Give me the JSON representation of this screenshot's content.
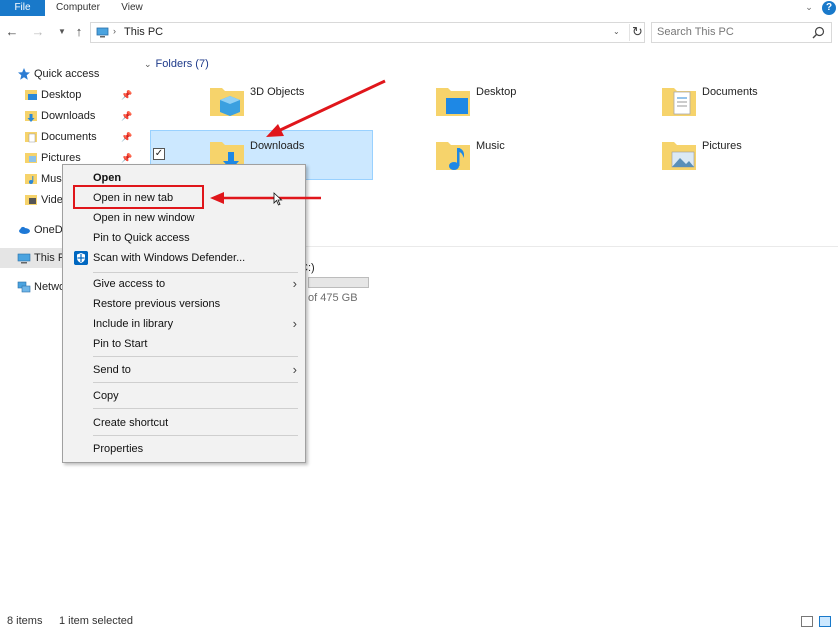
{
  "ribbon": {
    "tabs": [
      "File",
      "Computer",
      "View"
    ]
  },
  "address": {
    "location": "This PC",
    "search_placeholder": "Search This PC"
  },
  "nav_pane": {
    "items": [
      {
        "label": "Quick access"
      },
      {
        "label": "Desktop"
      },
      {
        "label": "Downloads"
      },
      {
        "label": "Documents"
      },
      {
        "label": "Pictures"
      },
      {
        "label": "Music"
      },
      {
        "label": "Videos"
      },
      {
        "label": "OneDrive"
      },
      {
        "label": "This PC"
      },
      {
        "label": "Network"
      }
    ]
  },
  "content": {
    "folders_header": "Folders (7)",
    "folders": [
      {
        "name": "3D Objects"
      },
      {
        "name": "Desktop"
      },
      {
        "name": "Documents"
      },
      {
        "name": "Downloads"
      },
      {
        "name": "Music"
      },
      {
        "name": "Pictures"
      }
    ],
    "drive": {
      "label": "C:)",
      "size_text": "of 475 GB",
      "used_fraction": 0.0
    }
  },
  "context_menu": {
    "items": [
      "Open",
      "Open in new tab",
      "Open in new window",
      "Pin to Quick access",
      "Scan with Windows Defender...",
      "Give access to",
      "Restore previous versions",
      "Include in library",
      "Pin to Start",
      "Send to",
      "Copy",
      "Create shortcut",
      "Properties"
    ]
  },
  "status": {
    "count": "8 items",
    "selected": "1 item selected"
  },
  "colors": {
    "accent": "#1979ca",
    "selection": "#cce8ff",
    "annotation": "#e0161b"
  }
}
